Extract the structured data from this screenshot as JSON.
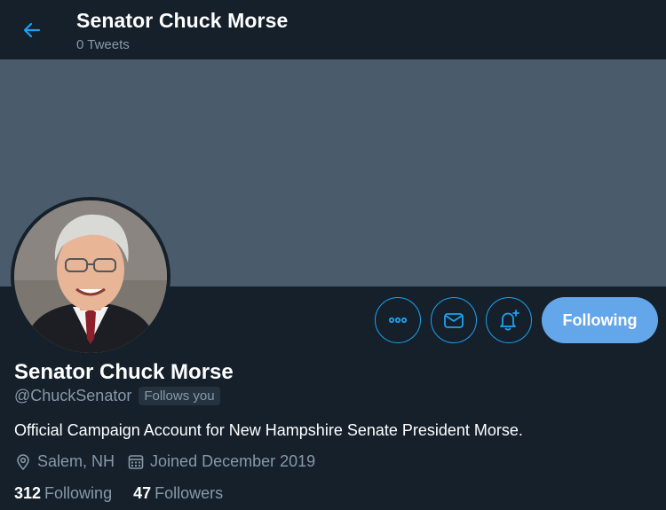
{
  "header": {
    "title": "Senator Chuck Morse",
    "tweet_count": "0 Tweets",
    "back_icon": "arrow-left-icon"
  },
  "profile": {
    "display_name": "Senator Chuck Morse",
    "handle": "@ChuckSenator",
    "follows_you_badge": "Follows you",
    "bio": "Official Campaign Account for New Hampshire Senate President Morse.",
    "location": "Salem, NH",
    "joined": "Joined December 2019",
    "following_count": "312",
    "following_label": "Following",
    "followers_count": "47",
    "followers_label": "Followers"
  },
  "actions": {
    "more_icon": "more-horizontal-icon",
    "message_icon": "envelope-icon",
    "notify_icon": "bell-plus-icon",
    "follow_button_label": "Following"
  },
  "colors": {
    "background": "#15202b",
    "banner": "#4a5b6b",
    "accent": "#1da1f2",
    "following_button": "#64a6ea",
    "secondary_text": "#8899a6"
  }
}
